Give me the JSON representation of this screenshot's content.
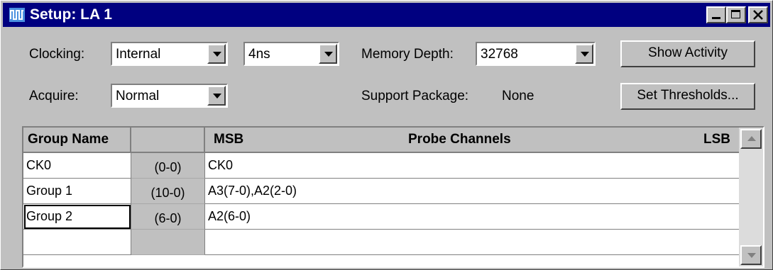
{
  "window": {
    "title": "Setup: LA 1"
  },
  "controls": {
    "clocking_label": "Clocking:",
    "clocking_value": "Internal",
    "period_value": "4ns",
    "memory_label": "Memory Depth:",
    "memory_value": "32768",
    "acquire_label": "Acquire:",
    "acquire_value": "Normal",
    "support_label": "Support Package:",
    "support_value": "None",
    "show_activity": "Show Activity",
    "set_thresholds": "Set Thresholds..."
  },
  "table": {
    "headers": {
      "group_name": "Group Name",
      "msb": "MSB",
      "probe_channels": "Probe Channels",
      "lsb": "LSB"
    },
    "rows": [
      {
        "name": "CK0",
        "range": "(0-0)",
        "channels": "CK0"
      },
      {
        "name": "Group 1",
        "range": "(10-0)",
        "channels": "A3(7-0),A2(2-0)"
      },
      {
        "name": "Group 2",
        "range": "(6-0)",
        "channels": "A2(6-0)"
      }
    ]
  },
  "colors": {
    "title_bar": "#000080",
    "face": "#c0c0c0"
  }
}
